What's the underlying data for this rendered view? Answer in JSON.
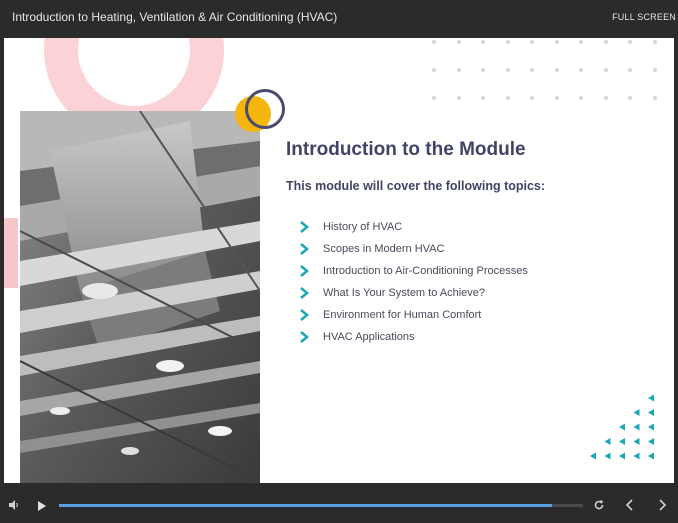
{
  "window": {
    "title": "Introduction to Heating, Ventilation & Air Conditioning (HVAC)",
    "fullscreen_label": "FULL SCREEN"
  },
  "slide": {
    "heading": "Introduction to the Module",
    "subheading": "This module will cover the following topics:",
    "topics": [
      "History of HVAC",
      "Scopes in Modern HVAC",
      "Introduction to Air-Conditioning Processes",
      "What Is Your System to Achieve?",
      "Environment for Human Comfort",
      "HVAC Applications"
    ],
    "photo_subject": "ceiling-ductwork-photo"
  },
  "player": {
    "progress_fraction": 0.94,
    "icons": [
      "volume-icon",
      "play-icon",
      "replay-icon",
      "previous-icon",
      "next-icon"
    ]
  },
  "colors": {
    "heading": "#414466",
    "accent_teal": "#1aa8b4",
    "accent_yellow": "#f5b50f",
    "accent_pink": "#fbd3d6",
    "progress": "#5aa1e3"
  }
}
